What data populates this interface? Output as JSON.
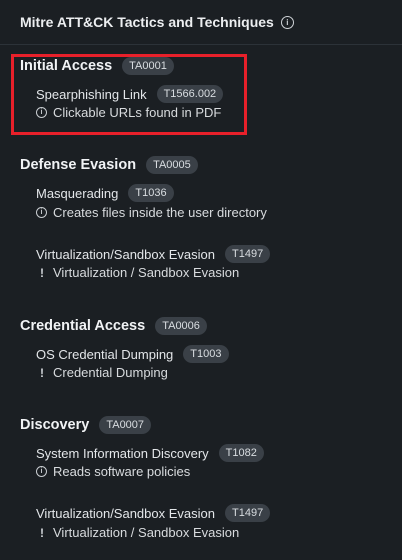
{
  "header": {
    "title": "Mitre ATT&CK Tactics and Techniques",
    "info_icon": "i"
  },
  "tactics": [
    {
      "name": "Initial Access",
      "id": "TA0001",
      "techniques": [
        {
          "name": "Spearphishing Link",
          "id": "T1566.002",
          "detail_icon": "info-icon",
          "detail": "Clickable URLs found in PDF"
        }
      ]
    },
    {
      "name": "Defense Evasion",
      "id": "TA0005",
      "techniques": [
        {
          "name": "Masquerading",
          "id": "T1036",
          "detail_icon": "info-icon",
          "detail": "Creates files inside the user directory"
        },
        {
          "name": "Virtualization/Sandbox Evasion",
          "id": "T1497",
          "detail_icon": "warning-icon",
          "detail": "Virtualization / Sandbox Evasion"
        }
      ]
    },
    {
      "name": "Credential Access",
      "id": "TA0006",
      "techniques": [
        {
          "name": "OS Credential Dumping",
          "id": "T1003",
          "detail_icon": "warning-icon",
          "detail": "Credential Dumping"
        }
      ]
    },
    {
      "name": "Discovery",
      "id": "TA0007",
      "techniques": [
        {
          "name": "System Information Discovery",
          "id": "T1082",
          "detail_icon": "info-icon",
          "detail": "Reads software policies"
        },
        {
          "name": "Virtualization/Sandbox Evasion",
          "id": "T1497",
          "detail_icon": "warning-icon",
          "detail": "Virtualization / Sandbox Evasion"
        }
      ]
    }
  ],
  "glyphs": {
    "info": "i",
    "warning": "!"
  },
  "colors": {
    "background": "#1b1f23",
    "badge": "#3a4047",
    "highlight": "#e8202a"
  }
}
